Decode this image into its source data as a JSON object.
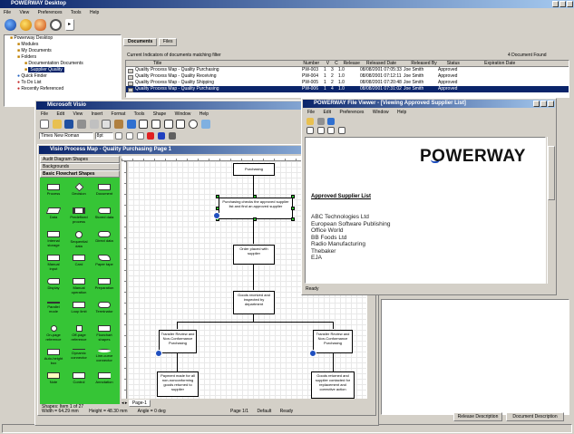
{
  "app": {
    "title": "POWERWAY Desktop",
    "menu": [
      "File",
      "View",
      "Preferences",
      "Tools",
      "Help"
    ]
  },
  "tree": {
    "items": [
      {
        "label": "Powerway Desktop"
      },
      {
        "label": "Modules"
      },
      {
        "label": "My Documents"
      },
      {
        "label": "Folders"
      },
      {
        "label": "Documentation Documents"
      },
      {
        "label": "Supplier Quality"
      },
      {
        "label": "Quick Finder"
      },
      {
        "label": "To Do List"
      },
      {
        "label": "Recently Referenced"
      }
    ]
  },
  "main": {
    "tabs": [
      "Documents",
      "Files"
    ],
    "info_left": "Current Indicators of documents matching filter",
    "info_right": "4 Document Found",
    "columns": [
      "Title",
      "Number",
      "V",
      "C",
      "Release",
      "Released Date",
      "Released By",
      "Status",
      "Expiration Date"
    ],
    "rows": [
      [
        "Quality Process Map - Quality Purchasing",
        "PW-003",
        "1",
        "3",
        "1.0",
        "08/08/2001 07:05:33",
        "Joe Smith",
        "Approved",
        ""
      ],
      [
        "Quality Process Map - Quality Receiving",
        "PW-004",
        "1",
        "2",
        "1.0",
        "08/08/2001 07:12:11",
        "Joe Smith",
        "Approved",
        ""
      ],
      [
        "Quality Process Map - Quality Shipping",
        "PW-005",
        "1",
        "2",
        "1.0",
        "08/08/2001 07:20:48",
        "Joe Smith",
        "Approved",
        ""
      ],
      [
        "Quality Process Map - Quality Purchasing",
        "PW-006",
        "1",
        "4",
        "1.0",
        "08/08/2001 07:31:02",
        "Joe Smith",
        "Approved",
        ""
      ]
    ],
    "buttons": [
      "Release Description",
      "Document Description"
    ]
  },
  "visio": {
    "title": "Microsoft Visio",
    "menu": [
      "File",
      "Edit",
      "View",
      "Insert",
      "Format",
      "Tools",
      "Shape",
      "Window",
      "Help"
    ],
    "font": "Times New Roman",
    "size": "8pt",
    "doc_title": "Visio Process Map - Quality Purchasing Page 1",
    "stencil_headers": [
      "Audit Diagram Shapes",
      "Backgrounds",
      "Basic Flowchart Shapes"
    ],
    "shapes": [
      "Process",
      "Decision",
      "Document",
      "Data",
      "Predefined process",
      "Stored data",
      "Internal storage",
      "Sequential data",
      "Direct data",
      "Manual input",
      "Card",
      "Paper tape",
      "Display",
      "Manual operation",
      "Preparation",
      "Parallel mode",
      "Loop limit",
      "Terminator",
      "On-page reference",
      "Off-page reference",
      "Flowchart shapes",
      "Auto-height box",
      "Dynamic connector",
      "Line-curve connector",
      "Note",
      "Control",
      "Annotation"
    ],
    "stencil_footer": "Shapes: Item 1 of 27",
    "flow": {
      "top": "Purchasing",
      "req": "Purchasing checks the approved supplier list and find an approved supplier",
      "order": "Order placed with supplier",
      "goods": "Goods received and inspected by department",
      "left": "Transfer Review and Non-Conformance Purchasing",
      "right": "Transfer Review and Non-Conformance Purchasing",
      "left2": "Payment made for all non-nonconforming goods returned to supplier",
      "right2": "Goods returned and supplier contacted for replacement and corrective action"
    },
    "page_tab": "Page-1",
    "status": [
      "Width = 64.29 mm",
      "Height = 48.30 mm",
      "Angle = 0 deg",
      "Page 1/1",
      "Default",
      "Ready"
    ]
  },
  "viewer": {
    "title": "POWERWAY File Viewer - [Viewing Approved Supplier List]",
    "menu": [
      "File",
      "Edit",
      "Preferences",
      "Window",
      "Help"
    ],
    "logo": "POWERWAY",
    "heading": "Approved Supplier List",
    "suppliers": [
      "ABC Technologies Ltd",
      "European Software Publishing",
      "Office World",
      "BB Foods Ltd",
      "Radio Manufacturing",
      "Thebaker",
      "EJA"
    ],
    "status": "Ready"
  }
}
